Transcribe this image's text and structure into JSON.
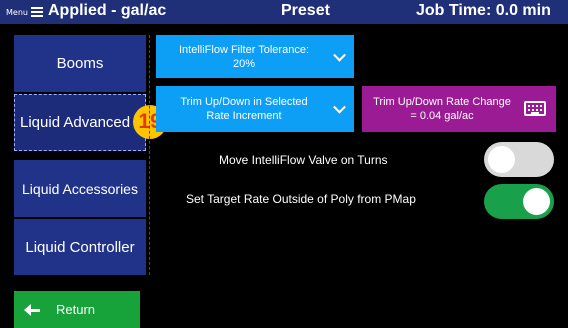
{
  "header": {
    "menu_label": "Menu",
    "title_left": "Applied - gal/ac",
    "title_mid": "Preset",
    "title_right": "Job Time: 0.0 min"
  },
  "nav": {
    "items": [
      {
        "label": "Booms"
      },
      {
        "label": "Liquid Advanced",
        "selected": true
      },
      {
        "label": "Liquid Accessories"
      },
      {
        "label": "Liquid Controller"
      }
    ],
    "badge": "19",
    "return_label": "Return"
  },
  "main": {
    "filter_tolerance_label": "IntelliFlow Filter Tolerance:",
    "filter_tolerance_value": "20%",
    "trim_line1": "Trim Up/Down in Selected",
    "trim_line2": "Rate Increment",
    "rate_change_line1": "Trim Up/Down Rate Change",
    "rate_change_line2": "= 0.04 gal/ac",
    "move_valve_label": "Move IntelliFlow Valve on Turns",
    "move_valve_on": false,
    "target_rate_label": "Set Target Rate Outside of Poly from PMap",
    "target_rate_on": true
  },
  "colors": {
    "header_bg": "#1f2f78",
    "nav_bg": "#213389",
    "tile_blue": "#0d9ff5",
    "tile_purple": "#9b1b95",
    "return_green": "#18a33a",
    "toggle_on": "#19a04a",
    "toggle_off": "#d9d9d9",
    "badge": "#ffc400"
  },
  "icons": {
    "menu": "hamburger-icon",
    "dropdown": "chevron-down-icon",
    "keyboard": "keyboard-icon",
    "return": "arrow-left-icon"
  }
}
